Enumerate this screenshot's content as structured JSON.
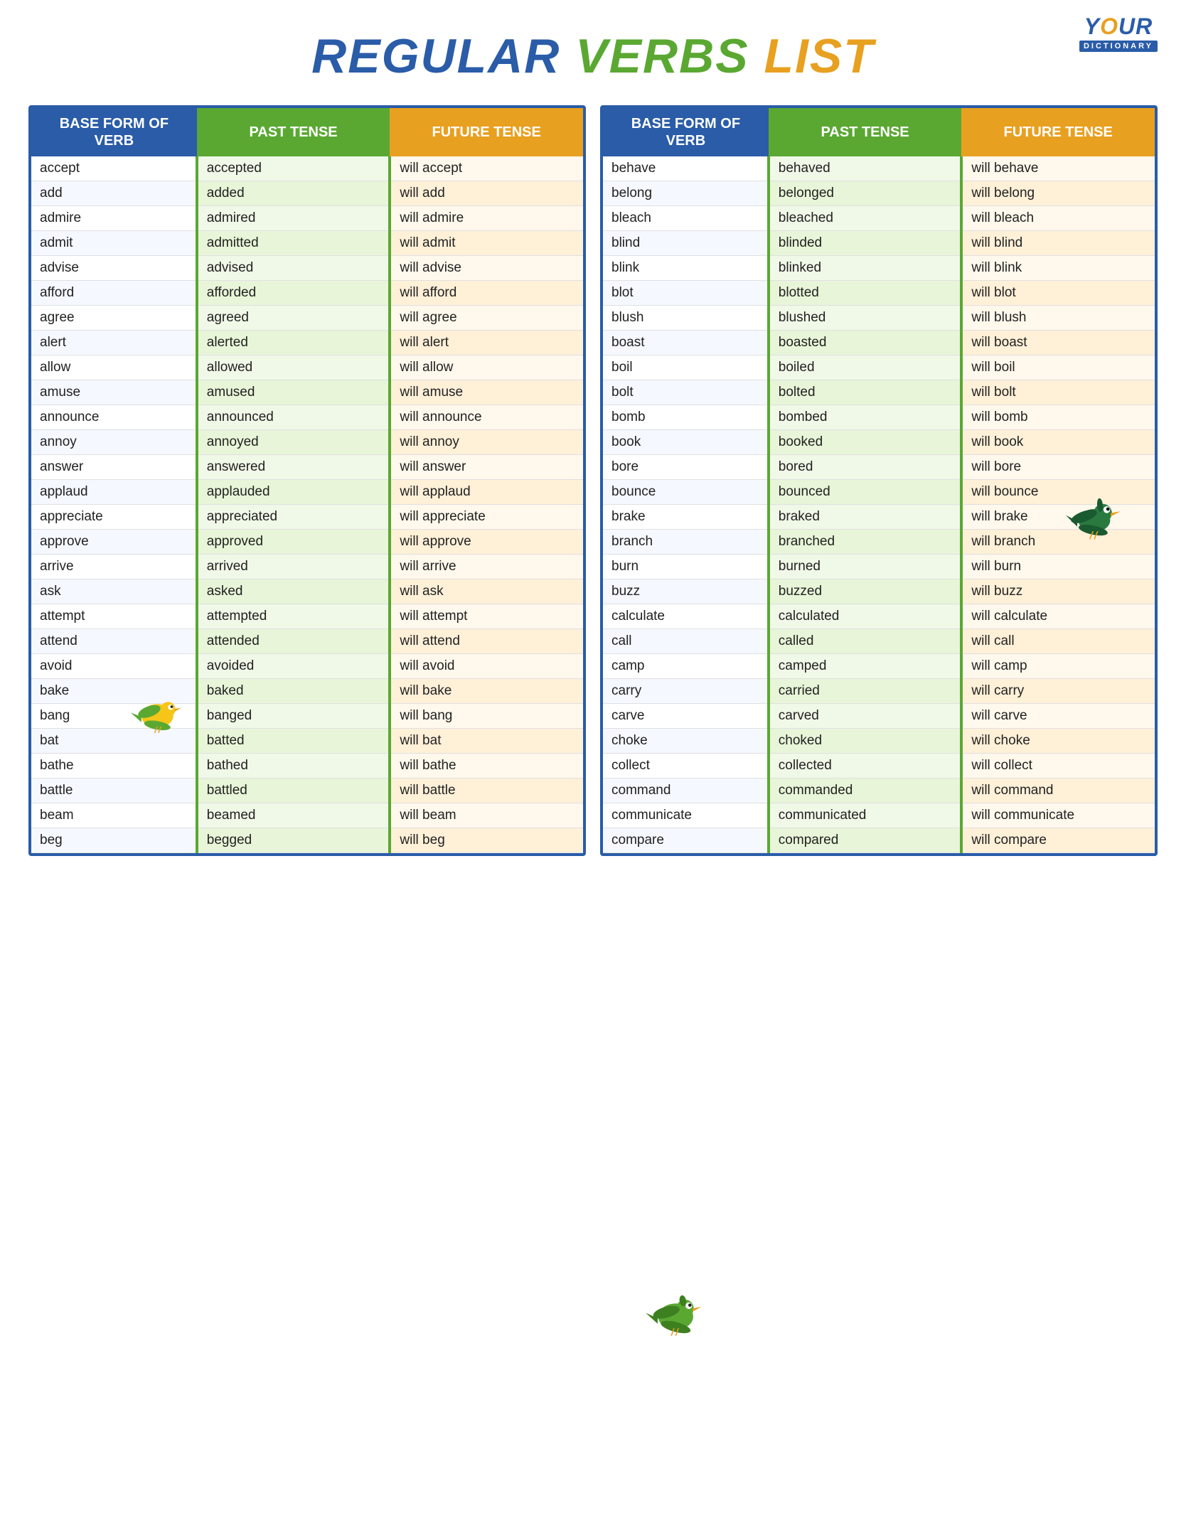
{
  "logo": {
    "your": "YOUR",
    "dictionary": "DICTIONARY"
  },
  "title": {
    "regular": "REGULAR",
    "verbs": "VERBS",
    "list": "LIST"
  },
  "headers": {
    "base": "BASE FORM OF VERB",
    "past": "PAST TENSE",
    "future": "FUTURE TENSE"
  },
  "left_table": [
    [
      "accept",
      "accepted",
      "will accept"
    ],
    [
      "add",
      "added",
      "will add"
    ],
    [
      "admire",
      "admired",
      "will admire"
    ],
    [
      "admit",
      "admitted",
      "will admit"
    ],
    [
      "advise",
      "advised",
      "will advise"
    ],
    [
      "afford",
      "afforded",
      "will afford"
    ],
    [
      "agree",
      "agreed",
      "will agree"
    ],
    [
      "alert",
      "alerted",
      "will alert"
    ],
    [
      "allow",
      "allowed",
      "will allow"
    ],
    [
      "amuse",
      "amused",
      "will amuse"
    ],
    [
      "announce",
      "announced",
      "will announce"
    ],
    [
      "annoy",
      "annoyed",
      "will annoy"
    ],
    [
      "answer",
      "answered",
      "will answer"
    ],
    [
      "applaud",
      "applauded",
      "will applaud"
    ],
    [
      "appreciate",
      "appreciated",
      "will appreciate"
    ],
    [
      "approve",
      "approved",
      "will approve"
    ],
    [
      "arrive",
      "arrived",
      "will arrive"
    ],
    [
      "ask",
      "asked",
      "will ask"
    ],
    [
      "attempt",
      "attempted",
      "will attempt"
    ],
    [
      "attend",
      "attended",
      "will attend"
    ],
    [
      "avoid",
      "avoided",
      "will avoid"
    ],
    [
      "bake",
      "baked",
      "will bake"
    ],
    [
      "bang",
      "banged",
      "will bang"
    ],
    [
      "bat",
      "batted",
      "will bat"
    ],
    [
      "bathe",
      "bathed",
      "will bathe"
    ],
    [
      "battle",
      "battled",
      "will battle"
    ],
    [
      "beam",
      "beamed",
      "will beam"
    ],
    [
      "beg",
      "begged",
      "will beg"
    ]
  ],
  "right_table": [
    [
      "behave",
      "behaved",
      "will behave"
    ],
    [
      "belong",
      "belonged",
      "will belong"
    ],
    [
      "bleach",
      "bleached",
      "will bleach"
    ],
    [
      "blind",
      "blinded",
      "will blind"
    ],
    [
      "blink",
      "blinked",
      "will blink"
    ],
    [
      "blot",
      "blotted",
      "will blot"
    ],
    [
      "blush",
      "blushed",
      "will blush"
    ],
    [
      "boast",
      "boasted",
      "will boast"
    ],
    [
      "boil",
      "boiled",
      "will boil"
    ],
    [
      "bolt",
      "bolted",
      "will bolt"
    ],
    [
      "bomb",
      "bombed",
      "will bomb"
    ],
    [
      "book",
      "booked",
      "will book"
    ],
    [
      "bore",
      "bored",
      "will bore"
    ],
    [
      "bounce",
      "bounced",
      "will bounce"
    ],
    [
      "brake",
      "braked",
      "will brake"
    ],
    [
      "branch",
      "branched",
      "will branch"
    ],
    [
      "burn",
      "burned",
      "will burn"
    ],
    [
      "buzz",
      "buzzed",
      "will buzz"
    ],
    [
      "calculate",
      "calculated",
      "will calculate"
    ],
    [
      "call",
      "called",
      "will call"
    ],
    [
      "camp",
      "camped",
      "will camp"
    ],
    [
      "carry",
      "carried",
      "will carry"
    ],
    [
      "carve",
      "carved",
      "will carve"
    ],
    [
      "choke",
      "choked",
      "will choke"
    ],
    [
      "collect",
      "collected",
      "will collect"
    ],
    [
      "command",
      "commanded",
      "will command"
    ],
    [
      "communicate",
      "communicated",
      "will communicate"
    ],
    [
      "compare",
      "compared",
      "will compare"
    ]
  ]
}
